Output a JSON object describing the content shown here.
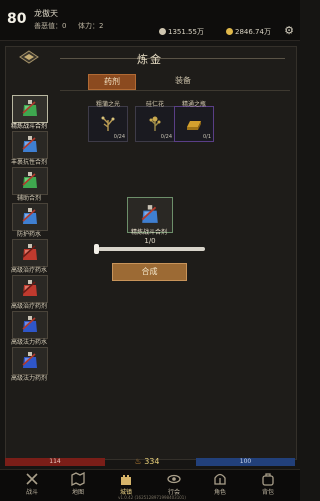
{
  "player": {
    "level": "80",
    "name": "龙傲天",
    "vip": "善恶值：0",
    "stamina": "体力：2",
    "silver": "1351.55万",
    "gold": "2846.74万"
  },
  "page": {
    "title": "炼金",
    "tabs": [
      "药剂",
      "装备"
    ]
  },
  "recipes": [
    {
      "label": "精炼战斗合剂",
      "color": "#3fa84f"
    },
    {
      "label": "丰裹抗性合剂",
      "color": "#3f7fd1"
    },
    {
      "label": "辅助合剂",
      "color": "#3fa84f"
    },
    {
      "label": "防护药水",
      "color": "#3f7fd1"
    },
    {
      "label": "高级治疗药水",
      "color": "#c03a2e"
    },
    {
      "label": "高级治疗药剂",
      "color": "#c03a2e"
    },
    {
      "label": "高级法力药水",
      "color": "#2f56c8"
    },
    {
      "label": "高级法力药剂",
      "color": "#2f56c8"
    }
  ],
  "materials": [
    {
      "name": "粗蒲之光",
      "count": "0/24"
    },
    {
      "name": "硅仁花",
      "count": "0/24"
    },
    {
      "name": "精通之瓶",
      "count": "0/1"
    }
  ],
  "craft": {
    "item": "精炼战斗合剂",
    "count": "1/0",
    "button": "合成"
  },
  "stats": {
    "hp": "114",
    "power": "334",
    "mp": "100"
  },
  "nav": [
    "战斗",
    "地图",
    "城镇",
    "行会",
    "角色",
    "背包"
  ],
  "version": "v1.0.42 (1625128971998403101)"
}
